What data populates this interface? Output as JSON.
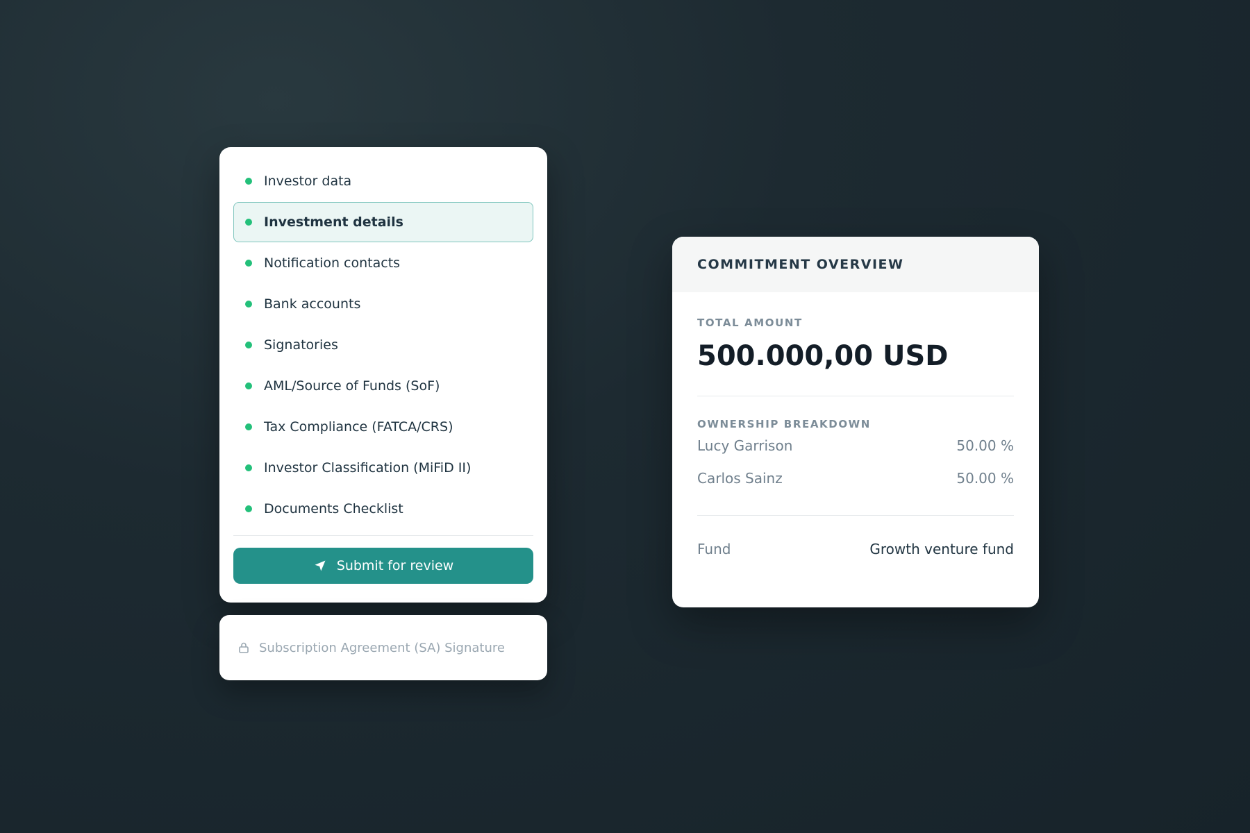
{
  "steps": {
    "items": [
      {
        "label": "Investor data",
        "active": false
      },
      {
        "label": "Investment details",
        "active": true
      },
      {
        "label": "Notification contacts",
        "active": false
      },
      {
        "label": "Bank accounts",
        "active": false
      },
      {
        "label": "Signatories",
        "active": false
      },
      {
        "label": "AML/Source of Funds (SoF)",
        "active": false
      },
      {
        "label": "Tax Compliance (FATCA/CRS)",
        "active": false
      },
      {
        "label": "Investor Classification (MiFiD II)",
        "active": false
      },
      {
        "label": "Documents Checklist",
        "active": false
      }
    ],
    "status_color": "#23c07a",
    "submit_label": "Submit for review",
    "submit_icon": "send-arrow-icon",
    "accent_color": "#24918a"
  },
  "locked_step": {
    "icon": "lock-icon",
    "label": "Subscription Agreement (SA) Signature"
  },
  "commitment": {
    "title": "COMMITMENT OVERVIEW",
    "total_label": "TOTAL AMOUNT",
    "total_amount": "500.000,00 USD",
    "ownership_label": "OWNERSHIP BREAKDOWN",
    "owners": [
      {
        "name": "Lucy Garrison",
        "share": "50.00 %"
      },
      {
        "name": "Carlos Sainz",
        "share": "50.00 %"
      }
    ],
    "fund_label": "Fund",
    "fund_value": "Growth venture fund"
  }
}
